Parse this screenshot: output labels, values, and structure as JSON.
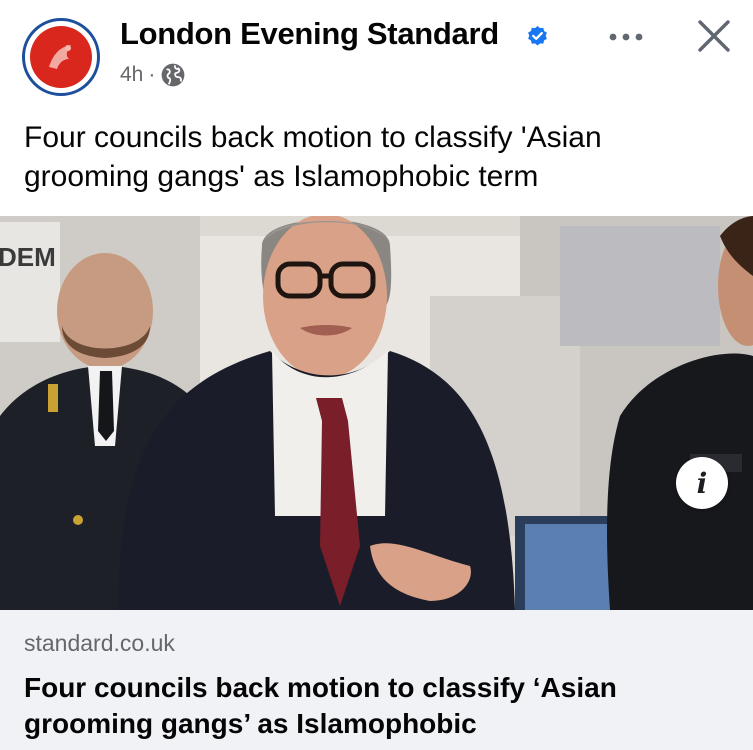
{
  "post": {
    "page_name": "London Evening Standard",
    "verified_icon": "verified-badge-icon",
    "time": "4h",
    "separator": "·",
    "audience_icon": "globe-icon",
    "more_icon": "more-options-icon",
    "close_icon": "close-icon",
    "text": "Four councils back motion to classify 'Asian grooming gangs' as Islamophobic term"
  },
  "photo": {
    "info_icon_glyph": "i",
    "visible_sign_text": "DEM"
  },
  "link": {
    "domain": "standard.co.uk",
    "title": "Four councils back motion to classify ‘Asian grooming gangs’ as Islamophobic"
  },
  "colors": {
    "verified_blue": "#1877f2",
    "avatar_red": "#d9271d",
    "avatar_ring": "#1d4f9c",
    "secondary_text": "#65676b",
    "card_bg": "#f0f2f5"
  }
}
